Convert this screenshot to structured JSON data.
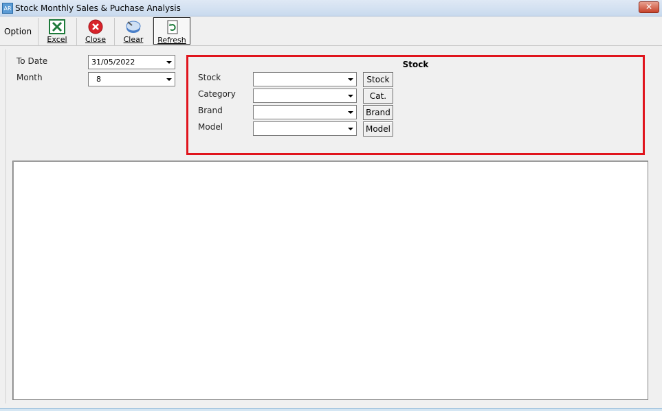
{
  "window": {
    "icon_text": "AR",
    "title": "Stock Monthly Sales & Puchase Analysis",
    "close_glyph": "✕"
  },
  "toolbar": {
    "option_label": "Option",
    "excel_label": "Excel",
    "close_label": "Close",
    "clear_label": "Clear",
    "refresh_label": "Refresh"
  },
  "params": {
    "to_date_label": "To Date",
    "to_date_value": "31/05/2022",
    "month_label": "Month",
    "month_value": "8"
  },
  "stock_group": {
    "title": "Stock",
    "fields": [
      {
        "label": "Stock",
        "value": "",
        "button": "Stock"
      },
      {
        "label": "Category",
        "value": "",
        "button": "Cat."
      },
      {
        "label": "Brand",
        "value": "",
        "button": "Brand"
      },
      {
        "label": "Model",
        "value": "",
        "button": "Model"
      }
    ]
  },
  "colors": {
    "highlight_border": "#e0141c",
    "excel_green": "#1d7a3a",
    "close_red": "#d8232a"
  }
}
